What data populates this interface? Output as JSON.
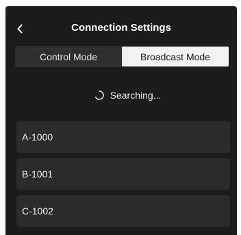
{
  "header": {
    "title": "Connection Settings"
  },
  "tabs": [
    {
      "label": "Control Mode",
      "selected": false
    },
    {
      "label": "Broadcast Mode",
      "selected": true
    }
  ],
  "status": {
    "text": "Searching..."
  },
  "devices": [
    {
      "name": "A-1000"
    },
    {
      "name": "B-1001"
    },
    {
      "name": "C-1002"
    }
  ],
  "icons": {
    "back": "chevron-left-icon",
    "spinner": "loading-spinner-icon"
  },
  "colors": {
    "background": "#1c1c1c",
    "tab_selected": "#f2f2f2",
    "tab_unselected": "#2f2f2f",
    "list_item": "#2b2b2b",
    "text": "#ffffff"
  }
}
